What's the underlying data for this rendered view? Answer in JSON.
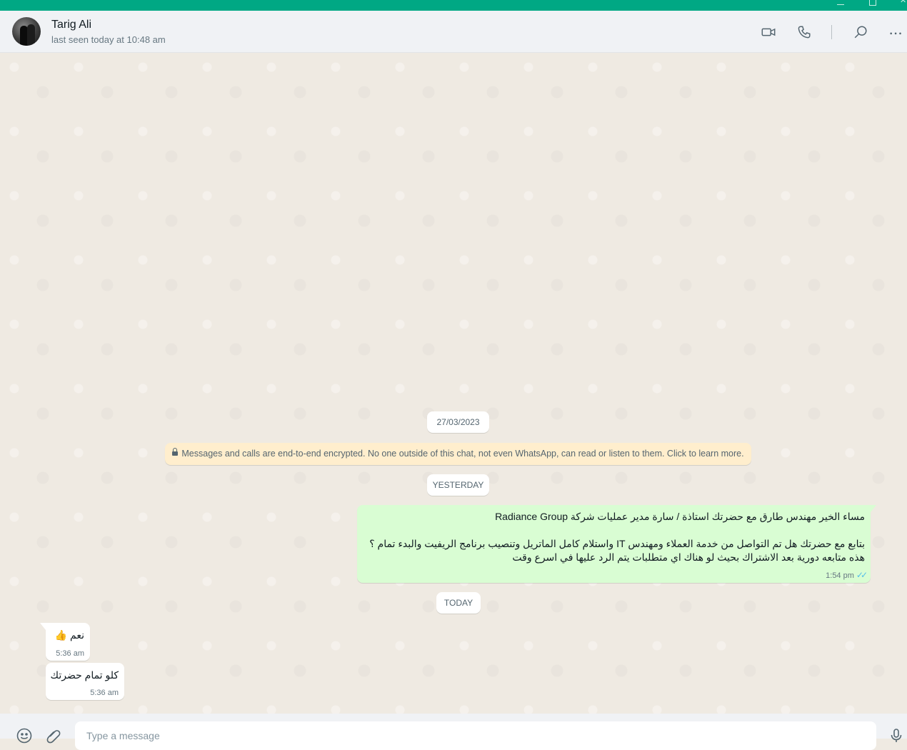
{
  "colors": {
    "accent": "#00a884",
    "outgoing_bubble": "#d9fdd3",
    "incoming_bubble": "#ffffff",
    "encryption_notice_bg": "#ffeecd",
    "read_ticks": "#53bdeb"
  },
  "header": {
    "contact_name": "Tarig Ali",
    "last_seen": "last seen today at 10:48 am",
    "icons": [
      "video-call-icon",
      "voice-call-icon",
      "search-icon",
      "more-options-icon"
    ]
  },
  "chat": {
    "date_label_1": "27/03/2023",
    "encryption_notice": "Messages and calls are end-to-end encrypted. No one outside of this chat, not even WhatsApp, can read or listen to them. Click to learn more.",
    "date_label_2": "YESTERDAY",
    "outgoing_message": {
      "line1": "مساء الخير مهندس طارق مع حضرتك استاذة / سارة مدير عمليات شركة Radiance Group",
      "line2": "بتابع مع حضرتك هل تم التواصل من خدمة العملاء ومهندس IT واستلام كامل الماتريل وتنصيب برنامج الريفيت والبدء تمام ؟",
      "line3": "هذه متابعه دورية بعد الاشتراك بحيث لو هناك اي متطلبات يتم الرد عليها في اسرع وقت",
      "time": "1:54 pm",
      "status": "read"
    },
    "date_label_3": "TODAY",
    "incoming_messages": [
      {
        "text": "نعم 👍",
        "time": "5:36 am"
      },
      {
        "text": "كلو تمام حضرتك",
        "time": "5:36 am"
      }
    ]
  },
  "composer": {
    "placeholder": "Type a message",
    "icons": [
      "emoji-icon",
      "attach-icon",
      "microphone-icon"
    ]
  }
}
